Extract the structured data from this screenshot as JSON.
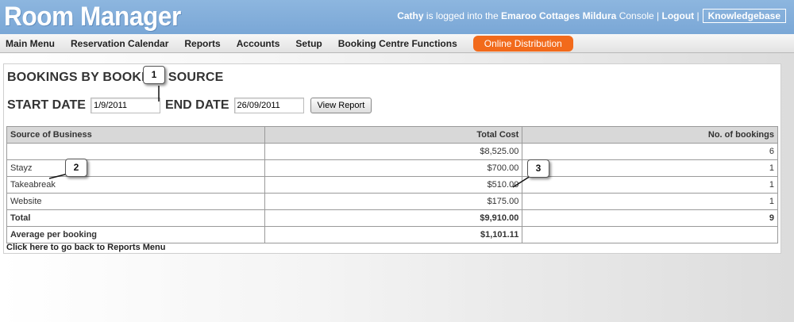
{
  "app": {
    "title": "Room Manager"
  },
  "header": {
    "user": "Cathy",
    "logged_text": "is logged into the",
    "property": "Emaroo Cottages Mildura",
    "console_text": "Console |",
    "logout": "Logout",
    "separator": "|",
    "knowledgebase": "Knowledgebase"
  },
  "nav": {
    "items": [
      "Main Menu",
      "Reservation Calendar",
      "Reports",
      "Accounts",
      "Setup",
      "Booking Centre Functions"
    ],
    "online": "Online Distribution",
    "online_color": "#f26a1b"
  },
  "report": {
    "title": "BOOKINGS BY BOOKING SOURCE",
    "start_label": "START DATE",
    "start_value": "1/9/2011",
    "end_label": "END DATE",
    "end_value": "26/09/2011",
    "view_button": "View Report"
  },
  "table": {
    "headers": [
      "Source of Business",
      "Total Cost",
      "No. of bookings"
    ],
    "rows": [
      {
        "source": "",
        "cost": "$8,525.00",
        "count": "6"
      },
      {
        "source": "Stayz",
        "cost": "$700.00",
        "count": "1"
      },
      {
        "source": "Takeabreak",
        "cost": "$510.00",
        "count": "1"
      },
      {
        "source": "Website",
        "cost": "$175.00",
        "count": "1"
      }
    ],
    "total": {
      "label": "Total",
      "cost": "$9,910.00",
      "count": "9"
    },
    "average": {
      "label": "Average per booking",
      "cost": "$1,101.11",
      "count": ""
    }
  },
  "back_link": "Click here to go back to Reports Menu",
  "callouts": [
    "1",
    "2",
    "3"
  ]
}
